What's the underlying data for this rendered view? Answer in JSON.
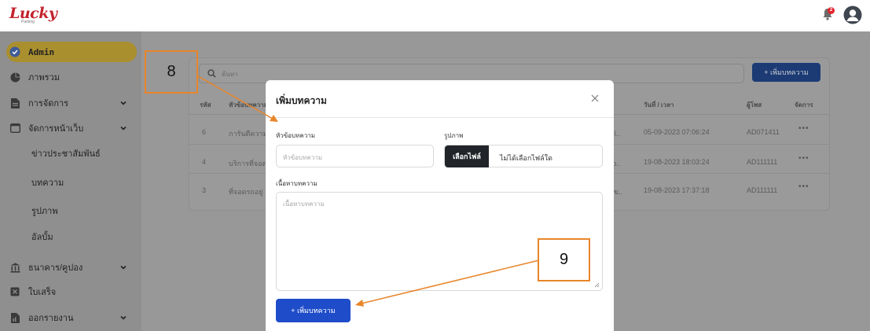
{
  "brand": {
    "logo_text": "Lucky",
    "logo_sub": "Parking"
  },
  "header": {
    "notification_count": "2"
  },
  "sidebar": {
    "items": [
      {
        "label": "Admin",
        "icon": "check-circle-icon",
        "active": true
      },
      {
        "label": "ภาพรวม",
        "icon": "pie-chart-icon"
      },
      {
        "label": "การจัดการ",
        "icon": "document-icon",
        "expandable": true
      },
      {
        "label": "จัดการหน้าเว็บ",
        "icon": "window-icon",
        "expandable": true
      },
      {
        "label": "ธนาคาร/คูปอง",
        "icon": "bank-icon",
        "expandable": true
      },
      {
        "label": "ใบเสร็จ",
        "icon": "receipt-icon"
      },
      {
        "label": "ออกรายงาน",
        "icon": "report-icon",
        "expandable": true
      }
    ],
    "subitems": [
      "ข่าวประชาสัมพันธ์",
      "บทความ",
      "รูปภาพ",
      "อัลบั้ม"
    ]
  },
  "content": {
    "search_placeholder": "ค้นหา",
    "add_button": "+ เพิ่มบทความ",
    "columns": [
      "รหัส",
      "หัวข้อบทความ",
      "วันที่ / เวลา",
      "ผู้โพส",
      "จัดการ"
    ],
    "rows": [
      {
        "id": "6",
        "title": "การันตีความ",
        "title_tail": "ง l..",
        "datetime": "05-09-2023 07:06:24",
        "poster": "AD071411",
        "action": "•••"
      },
      {
        "id": "4",
        "title": "บริการที่จอด",
        "title_tail": "ใo..",
        "datetime": "19-08-2023 18:03:24",
        "poster": "AD111111",
        "action": "•••"
      },
      {
        "id": "3",
        "title": "ที่จอดรถอยู่",
        "title_tail": "บข..",
        "datetime": "19-08-2023 17:37:18",
        "poster": "AD111111",
        "action": "•••"
      }
    ]
  },
  "modal": {
    "title": "เพิ่มบทความ",
    "close_icon": "close-icon",
    "headline_label": "หัวข้อบทความ",
    "headline_placeholder": "หัวข้อบทความ",
    "image_label": "รูปภาพ",
    "file_button": "เลือกไฟล์",
    "file_status": "ไม่ได้เลือกไฟล์ใด",
    "content_label": "เนื้อหาบทความ",
    "content_placeholder": "เนื้อหาบทความ",
    "submit_label": "+ เพิ่มบทความ"
  },
  "annotations": {
    "callout_a": "8",
    "callout_b": "9"
  },
  "colors": {
    "accent": "#1f4cc9",
    "brand": "#c3212c",
    "callout": "#e8852a",
    "active_nav": "#d4af37"
  }
}
